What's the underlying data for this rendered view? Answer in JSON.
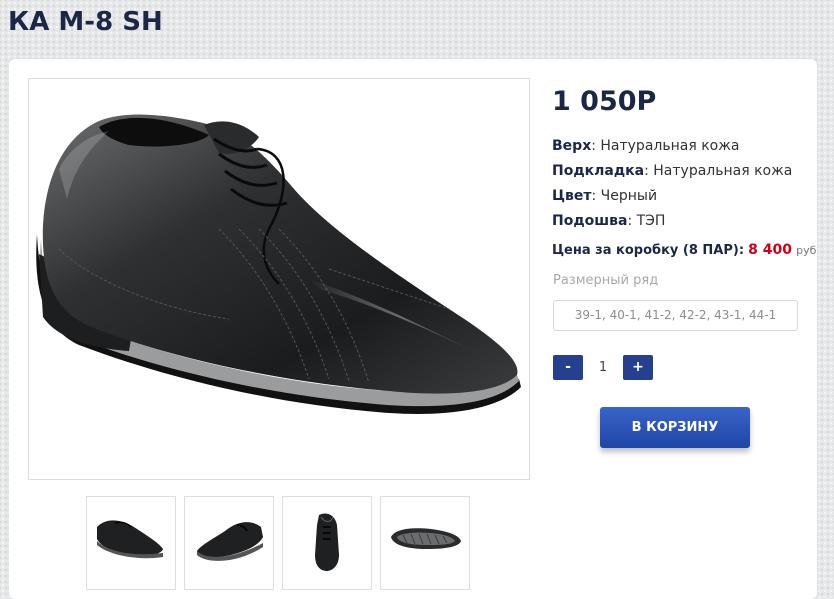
{
  "product": {
    "title": "КА М-8 SH",
    "price": "1 050Р",
    "specs": [
      {
        "label": "Верх",
        "value": ": Натуральная кожа"
      },
      {
        "label": "Подкладка",
        "value": ": Натуральная кожа"
      },
      {
        "label": "Цвет",
        "value": ": Черный"
      },
      {
        "label": "Подошва",
        "value": ": ТЭП"
      }
    ],
    "box_price": {
      "label": "Цена за коробку (8 ПАР):",
      "value": "8 400",
      "currency": "руб",
      "value_color": "#d0001a"
    },
    "size_range": {
      "label": "Размерный ряд",
      "value": "39-1, 40-1, 41-2, 42-2, 43-1, 44-1"
    }
  },
  "quantity": {
    "minus_label": "-",
    "value": "1",
    "plus_label": "+"
  },
  "cart_button_label": "В КОРЗИНУ",
  "images": {
    "main": "black-leather-shoe-photo",
    "thumbnails": [
      "shoe-side-view",
      "shoe-angle-view",
      "shoe-front-view",
      "shoe-sole-view"
    ]
  },
  "colors": {
    "title": "#1b2745",
    "accent": "#25408f",
    "price_highlight": "#d0001a"
  }
}
